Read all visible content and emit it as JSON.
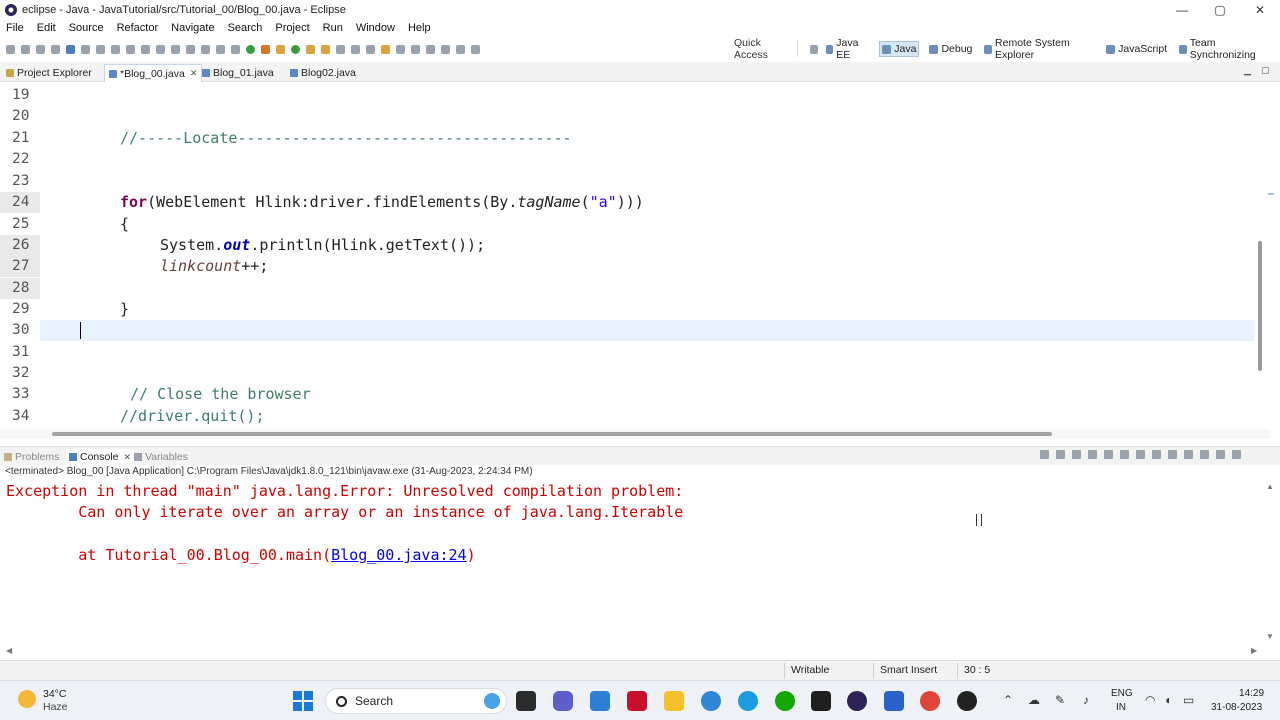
{
  "window": {
    "title": "eclipse - Java - JavaTutorial/src/Tutorial_00/Blog_00.java - Eclipse",
    "minimize": "—",
    "maximize": "▢",
    "close": "✕"
  },
  "menu": [
    "File",
    "Edit",
    "Source",
    "Refactor",
    "Navigate",
    "Search",
    "Project",
    "Run",
    "Window",
    "Help"
  ],
  "toolbar": {
    "quick_access": "Quick Access",
    "perspectives": [
      {
        "label": "Java EE",
        "active": false
      },
      {
        "label": "Java",
        "active": true
      },
      {
        "label": "Debug",
        "active": false
      },
      {
        "label": "Remote System Explorer",
        "active": false
      },
      {
        "label": "JavaScript",
        "active": false
      },
      {
        "label": "Team Synchronizing",
        "active": false
      }
    ]
  },
  "editor_tabs": [
    {
      "label": "Project Explorer",
      "active": false
    },
    {
      "label": "*Blog_00.java",
      "active": true,
      "close": "✕"
    },
    {
      "label": "Blog_01.java",
      "active": false
    },
    {
      "label": "Blog02.java",
      "active": false
    }
  ],
  "editor": {
    "line_numbers": [
      "19",
      "20",
      "21",
      "22",
      "23",
      "24",
      "25",
      "26",
      "27",
      "28",
      "29",
      "30",
      "31",
      "32",
      "33",
      "34"
    ],
    "highlighted_numbers": [
      "24",
      "26",
      "27",
      "28"
    ],
    "current_line": "30",
    "lines": {
      "l21": "//-----Locate-------------------------------------",
      "l24_kw": "for",
      "l24_a": "(WebElement Hlink:driver.findElements(By.",
      "l24_it": "tagName",
      "l24_b": "(",
      "l24_str": "\"a\"",
      "l24_c": ")))",
      "l25": "{",
      "l26_a": "System.",
      "l26_fld": "out",
      "l26_b": ".println(Hlink.getText());",
      "l27_var": "linkcount",
      "l27_b": "++;",
      "l29": "}",
      "l33": "// Close the browser",
      "l34": "//driver.quit();"
    }
  },
  "console": {
    "tabs": [
      {
        "label": "Problems",
        "active": false
      },
      {
        "label": "Console",
        "active": true,
        "close": "✕"
      },
      {
        "label": "Variables",
        "active": false
      }
    ],
    "terminated": "<terminated> Blog_00 [Java Application] C:\\Program Files\\Java\\jdk1.8.0_121\\bin\\javaw.exe (31-Aug-2023, 2:24:34 PM)",
    "line1": "Exception in thread \"main\" java.lang.Error: Unresolved compilation problem: ",
    "line2": "        Can only iterate over an array or an instance of java.lang.Iterable",
    "line3_prefix": "        at Tutorial_00.Blog_00.main(",
    "line3_link": "Blog_00.java:24",
    "line3_suffix": ")"
  },
  "statusbar": {
    "writable": "Writable",
    "insert_mode": "Smart Insert",
    "position": "30 : 5"
  },
  "taskbar": {
    "temperature": "34°C",
    "condition": "Haze",
    "search_label": "Search",
    "lang_line1": "ENG",
    "lang_line2": "IN",
    "time": "14:29",
    "date": "31-08-2023"
  },
  "colors": {
    "keyword": "#7f0055",
    "comment": "#3f7f5f",
    "string": "#2a00ff",
    "error": "#d10000",
    "link": "#0000ee",
    "current_line_bg": "#e8f2fe"
  }
}
